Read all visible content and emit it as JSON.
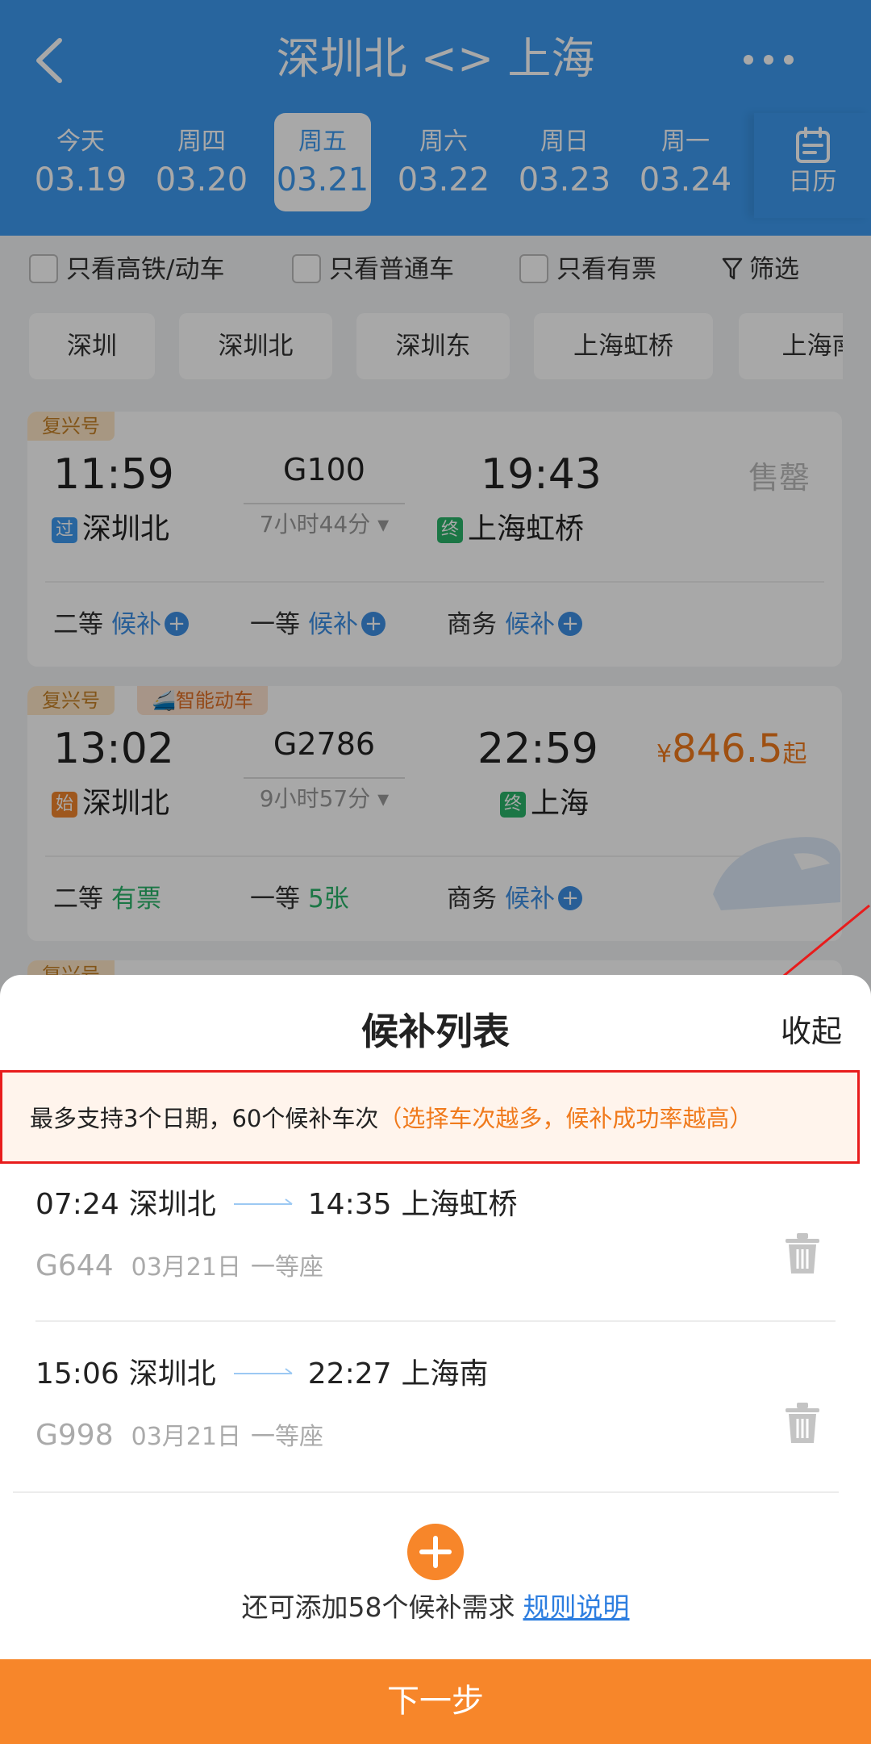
{
  "header": {
    "title": "深圳北 <> 上海",
    "dates": [
      {
        "weekday": "今天",
        "date": "03.19",
        "active": false
      },
      {
        "weekday": "周四",
        "date": "03.20",
        "active": false
      },
      {
        "weekday": "周五",
        "date": "03.21",
        "active": true
      },
      {
        "weekday": "周六",
        "date": "03.22",
        "active": false
      },
      {
        "weekday": "周日",
        "date": "03.23",
        "active": false
      },
      {
        "weekday": "周一",
        "date": "03.24",
        "active": false
      }
    ],
    "calendar_label": "日历"
  },
  "filters": {
    "only_high_speed": "只看高铁/动车",
    "only_regular": "只看普通车",
    "only_available": "只看有票",
    "filter_label": "筛选"
  },
  "stations": [
    "深圳",
    "深圳北",
    "深圳东",
    "上海虹桥",
    "上海南"
  ],
  "trains": [
    {
      "tags": [
        "复兴号"
      ],
      "depart_time": "11:59",
      "depart_station": "深圳北",
      "depart_badge": "过",
      "train_no": "G100",
      "duration": "7小时44分",
      "arrive_time": "19:43",
      "arrive_station": "上海虹桥",
      "arrive_badge": "终",
      "status": "售罄",
      "seats": [
        {
          "class": "二等",
          "status": "候补"
        },
        {
          "class": "一等",
          "status": "候补"
        },
        {
          "class": "商务",
          "status": "候补"
        }
      ]
    },
    {
      "tags": [
        "复兴号",
        "智能动车"
      ],
      "depart_time": "13:02",
      "depart_station": "深圳北",
      "depart_badge": "始",
      "train_no": "G2786",
      "duration": "9小时57分",
      "arrive_time": "22:59",
      "arrive_station": "上海",
      "arrive_badge": "终",
      "price_symbol": "¥",
      "price": "846.5",
      "price_suffix": "起",
      "seats": [
        {
          "class": "二等",
          "status": "有票"
        },
        {
          "class": "一等",
          "status": "5张"
        },
        {
          "class": "商务",
          "status": "候补"
        }
      ]
    }
  ],
  "next_card_tag": "复兴号",
  "sheet": {
    "title": "候补列表",
    "collapse_label": "收起",
    "notice_main": "最多支持3个日期，60个候补车次",
    "notice_highlight": "（选择车次越多，候补成功率越高）",
    "items": [
      {
        "depart_time": "07:24",
        "depart_station": "深圳北",
        "arrive_time": "14:35",
        "arrive_station": "上海虹桥",
        "train_no": "G644",
        "date": "03月21日",
        "seat": "一等座"
      },
      {
        "depart_time": "15:06",
        "depart_station": "深圳北",
        "arrive_time": "22:27",
        "arrive_station": "上海南",
        "train_no": "G998",
        "date": "03月21日",
        "seat": "一等座"
      }
    ],
    "add_hint": "还可添加58个候补需求",
    "rules_link": "规则说明",
    "next_button": "下一步"
  },
  "colors": {
    "brand_blue": "#3d9af0",
    "accent_orange": "#f7862a",
    "annotation_red": "#e81c1c"
  }
}
